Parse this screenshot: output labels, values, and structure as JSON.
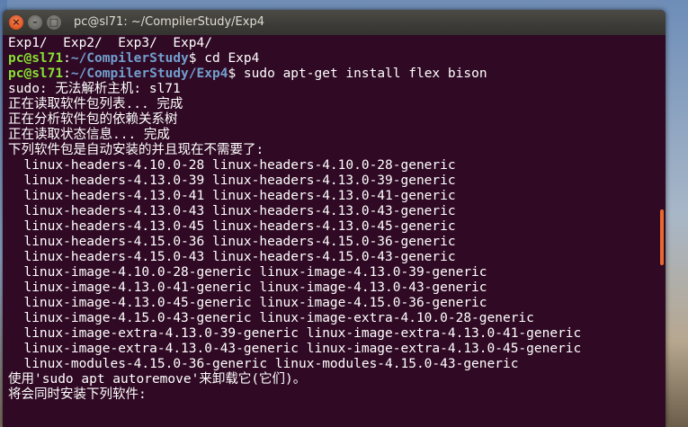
{
  "window": {
    "title": "pc@sl71: ~/CompilerStudy/Exp4",
    "buttons": {
      "close_glyph": "×",
      "minimize_glyph": "–",
      "maximize_glyph": "□"
    }
  },
  "colors": {
    "terminal_background": "#300a24",
    "prompt_user": "#8ae234",
    "prompt_path": "#729fcf",
    "text": "#ffffff",
    "close_button": "#e1541f"
  },
  "terminal": {
    "line0": "Exp1/  Exp2/  Exp3/  Exp4/",
    "cmd1": {
      "user": "pc@sl71",
      "sep": ":",
      "path": "~/CompilerStudy",
      "symbol": "$ ",
      "command": "cd Exp4"
    },
    "cmd2": {
      "user": "pc@sl71",
      "sep": ":",
      "path": "~/CompilerStudy/Exp4",
      "symbol": "$ ",
      "command": "sudo apt-get install flex bison"
    },
    "output": [
      "sudo: 无法解析主机: sl71",
      "正在读取软件包列表... 完成",
      "正在分析软件包的依赖关系树",
      "正在读取状态信息... 完成",
      "下列软件包是自动安装的并且现在不需要了:",
      "  linux-headers-4.10.0-28 linux-headers-4.10.0-28-generic",
      "  linux-headers-4.13.0-39 linux-headers-4.13.0-39-generic",
      "  linux-headers-4.13.0-41 linux-headers-4.13.0-41-generic",
      "  linux-headers-4.13.0-43 linux-headers-4.13.0-43-generic",
      "  linux-headers-4.13.0-45 linux-headers-4.13.0-45-generic",
      "  linux-headers-4.15.0-36 linux-headers-4.15.0-36-generic",
      "  linux-headers-4.15.0-43 linux-headers-4.15.0-43-generic",
      "  linux-image-4.10.0-28-generic linux-image-4.13.0-39-generic",
      "  linux-image-4.13.0-41-generic linux-image-4.13.0-43-generic",
      "  linux-image-4.13.0-45-generic linux-image-4.15.0-36-generic",
      "  linux-image-4.15.0-43-generic linux-image-extra-4.10.0-28-generic",
      "  linux-image-extra-4.13.0-39-generic linux-image-extra-4.13.0-41-generic",
      "  linux-image-extra-4.13.0-43-generic linux-image-extra-4.13.0-45-generic",
      "  linux-modules-4.15.0-36-generic linux-modules-4.15.0-43-generic",
      "使用'sudo apt autoremove'来卸载它(它们)。",
      "将会同时安装下列软件:"
    ]
  }
}
